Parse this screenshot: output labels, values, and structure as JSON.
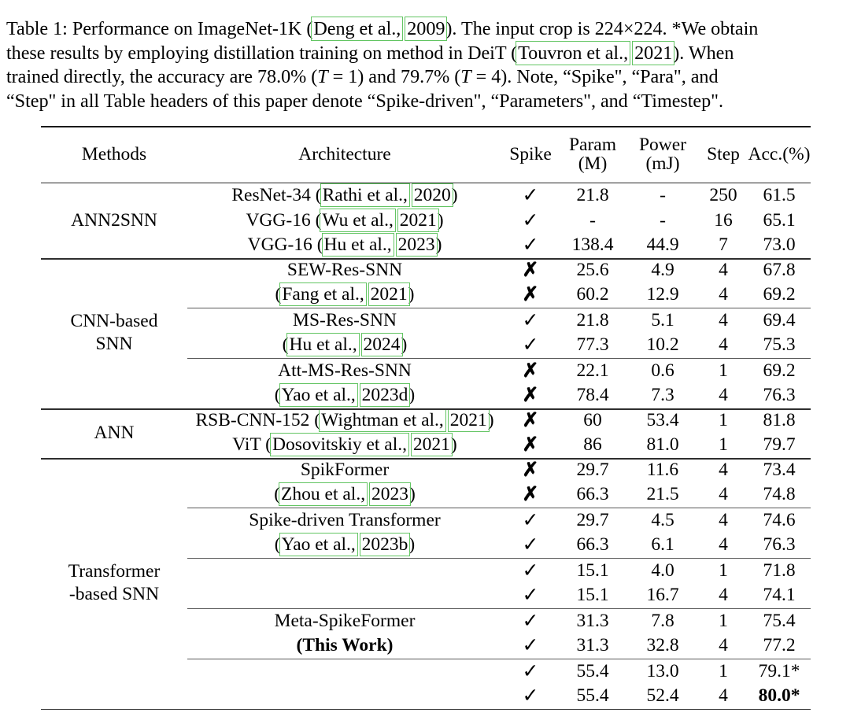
{
  "caption": {
    "lines": [
      [
        {
          "t": "Table 1: Performance on ImageNet-1K (",
          "hl": false
        },
        {
          "t": "Deng et al.,",
          "hl": true
        },
        {
          "t": " ",
          "hl": false
        },
        {
          "t": "2009",
          "hl": true
        },
        {
          "t": "). The input crop is 224×224. *We obtain",
          "hl": false
        }
      ],
      [
        {
          "t": "these results by employing distillation training on method in DeiT (",
          "hl": false
        },
        {
          "t": "Touvron et al.,",
          "hl": true
        },
        {
          "t": " ",
          "hl": false
        },
        {
          "t": "2021",
          "hl": true
        },
        {
          "t": "). When",
          "hl": false
        }
      ],
      [
        {
          "t": "trained directly, the accuracy are 78.0% (",
          "hl": false
        },
        {
          "t": "T",
          "hl": false,
          "italic": true
        },
        {
          "t": " = 1) and 79.7% (",
          "hl": false
        },
        {
          "t": "T",
          "hl": false,
          "italic": true
        },
        {
          "t": " = 4). Note, “Spike\", “Para\", and",
          "hl": false
        }
      ],
      [
        {
          "t": "“Step\" in all Table headers of this paper denote “Spike-driven\", “Parameters\", and “Timestep\".",
          "hl": false
        }
      ]
    ],
    "highlight_color": "#63c563"
  },
  "table": {
    "headers": {
      "methods": "Methods",
      "architecture": "Architecture",
      "spike": "Spike",
      "param_l1": "Param",
      "param_l2": "(M)",
      "power_l1": "Power",
      "power_l2": "(mJ)",
      "step": "Step",
      "acc": "Acc.(%)"
    },
    "marks": {
      "yes": "✓",
      "no": "✗"
    },
    "sections": [
      {
        "name": "ANN2SNN",
        "label_lines": [
          "ANN2SNN"
        ],
        "label_row_index": 1,
        "rows": [
          {
            "arch_parts": [
              {
                "t": "ResNet-34 (",
                "hl": false
              },
              {
                "t": "Rathi et al.,",
                "hl": true
              },
              {
                "t": " ",
                "hl": false
              },
              {
                "t": "2020",
                "hl": true
              },
              {
                "t": ")",
                "hl": false
              }
            ],
            "spike": "yes",
            "param": "21.8",
            "power": "-",
            "step": "250",
            "acc": "61.5",
            "acc_bold": false,
            "rule_after": "none"
          },
          {
            "arch_parts": [
              {
                "t": "VGG-16 (",
                "hl": false
              },
              {
                "t": "Wu et al.,",
                "hl": true
              },
              {
                "t": " ",
                "hl": false
              },
              {
                "t": "2021",
                "hl": true
              },
              {
                "t": ")",
                "hl": false
              }
            ],
            "spike": "yes",
            "param": "-",
            "power": "-",
            "step": "16",
            "acc": "65.1",
            "acc_bold": false,
            "rule_after": "none"
          },
          {
            "arch_parts": [
              {
                "t": "VGG-16 (",
                "hl": false
              },
              {
                "t": "Hu et al.,",
                "hl": true
              },
              {
                "t": " ",
                "hl": false
              },
              {
                "t": "2023",
                "hl": true
              },
              {
                "t": ")",
                "hl": false
              }
            ],
            "spike": "yes",
            "param": "138.4",
            "power": "44.9",
            "step": "7",
            "acc": "73.0",
            "acc_bold": false,
            "rule_after": "full"
          }
        ]
      },
      {
        "name": "CNN-based SNN",
        "label_lines": [
          "CNN-based",
          "SNN"
        ],
        "label_row_index": 2,
        "rows": [
          {
            "arch_parts": [
              {
                "t": "SEW-Res-SNN",
                "hl": false
              }
            ],
            "spike": "no",
            "param": "25.6",
            "power": "4.9",
            "step": "4",
            "acc": "67.8",
            "acc_bold": false,
            "rule_after": "none"
          },
          {
            "arch_parts": [
              {
                "t": "(",
                "hl": false
              },
              {
                "t": "Fang et al.,",
                "hl": true
              },
              {
                "t": " ",
                "hl": false
              },
              {
                "t": "2021",
                "hl": true
              },
              {
                "t": ")",
                "hl": false
              }
            ],
            "spike": "no",
            "param": "60.2",
            "power": "12.9",
            "step": "4",
            "acc": "69.2",
            "acc_bold": false,
            "rule_after": "part"
          },
          {
            "arch_parts": [
              {
                "t": "MS-Res-SNN",
                "hl": false
              }
            ],
            "spike": "yes",
            "param": "21.8",
            "power": "5.1",
            "step": "4",
            "acc": "69.4",
            "acc_bold": false,
            "rule_after": "none"
          },
          {
            "arch_parts": [
              {
                "t": "(",
                "hl": false
              },
              {
                "t": "Hu et al.,",
                "hl": true
              },
              {
                "t": " ",
                "hl": false
              },
              {
                "t": "2024",
                "hl": true
              },
              {
                "t": ")",
                "hl": false
              }
            ],
            "spike": "yes",
            "param": "77.3",
            "power": "10.2",
            "step": "4",
            "acc": "75.3",
            "acc_bold": false,
            "rule_after": "part"
          },
          {
            "arch_parts": [
              {
                "t": "Att-MS-Res-SNN",
                "hl": false
              }
            ],
            "spike": "no",
            "param": "22.1",
            "power": "0.6",
            "step": "1",
            "acc": "69.2",
            "acc_bold": false,
            "rule_after": "none"
          },
          {
            "arch_parts": [
              {
                "t": "(",
                "hl": false
              },
              {
                "t": "Yao et al.,",
                "hl": true
              },
              {
                "t": " ",
                "hl": false
              },
              {
                "t": "2023d",
                "hl": true
              },
              {
                "t": ")",
                "hl": false
              }
            ],
            "spike": "no",
            "param": "78.4",
            "power": "7.3",
            "step": "4",
            "acc": "76.3",
            "acc_bold": false,
            "rule_after": "full"
          }
        ]
      },
      {
        "name": "ANN",
        "label_lines": [
          "ANN"
        ],
        "label_row_index": 1,
        "rows": [
          {
            "arch_parts": [
              {
                "t": "RSB-CNN-152 (",
                "hl": false
              },
              {
                "t": "Wightman et al.,",
                "hl": true
              },
              {
                "t": " ",
                "hl": false
              },
              {
                "t": "2021",
                "hl": true
              },
              {
                "t": ")",
                "hl": false
              }
            ],
            "spike": "no",
            "param": "60",
            "power": "53.4",
            "step": "1",
            "acc": "81.8",
            "acc_bold": false,
            "rule_after": "none"
          },
          {
            "arch_parts": [
              {
                "t": "ViT (",
                "hl": false
              },
              {
                "t": "Dosovitskiy et al.,",
                "hl": true
              },
              {
                "t": " ",
                "hl": false
              },
              {
                "t": "2021",
                "hl": true
              },
              {
                "t": ")",
                "hl": false
              }
            ],
            "spike": "no",
            "param": "86",
            "power": "81.0",
            "step": "1",
            "acc": "79.7",
            "acc_bold": false,
            "rule_after": "full"
          }
        ]
      },
      {
        "name": "Transformer-based SNN",
        "label_lines": [
          "Transformer",
          "-based SNN"
        ],
        "label_row_index": 5,
        "rows": [
          {
            "arch_parts": [
              {
                "t": "SpikFormer",
                "hl": false
              }
            ],
            "spike": "no",
            "param": "29.7",
            "power": "11.6",
            "step": "4",
            "acc": "73.4",
            "acc_bold": false,
            "rule_after": "none"
          },
          {
            "arch_parts": [
              {
                "t": "(",
                "hl": false
              },
              {
                "t": "Zhou et al.,",
                "hl": true
              },
              {
                "t": " ",
                "hl": false
              },
              {
                "t": "2023",
                "hl": true
              },
              {
                "t": ")",
                "hl": false
              }
            ],
            "spike": "no",
            "param": "66.3",
            "power": "21.5",
            "step": "4",
            "acc": "74.8",
            "acc_bold": false,
            "rule_after": "part"
          },
          {
            "arch_parts": [
              {
                "t": "Spike-driven Transformer",
                "hl": false
              }
            ],
            "spike": "yes",
            "param": "29.7",
            "power": "4.5",
            "step": "4",
            "acc": "74.6",
            "acc_bold": false,
            "rule_after": "none"
          },
          {
            "arch_parts": [
              {
                "t": "(",
                "hl": false
              },
              {
                "t": "Yao et al.,",
                "hl": true
              },
              {
                "t": " ",
                "hl": false
              },
              {
                "t": "2023b",
                "hl": true
              },
              {
                "t": ")",
                "hl": false
              }
            ],
            "spike": "yes",
            "param": "66.3",
            "power": "6.1",
            "step": "4",
            "acc": "76.3",
            "acc_bold": false,
            "rule_after": "part"
          },
          {
            "arch_parts": [],
            "spike": "yes",
            "param": "15.1",
            "power": "4.0",
            "step": "1",
            "acc": "71.8",
            "acc_bold": false,
            "rule_after": "none"
          },
          {
            "arch_parts": [],
            "spike": "yes",
            "param": "15.1",
            "power": "16.7",
            "step": "4",
            "acc": "74.1",
            "acc_bold": false,
            "rule_after": "part"
          },
          {
            "arch_parts": [
              {
                "t": "Meta-SpikeFormer",
                "hl": false
              }
            ],
            "spike": "yes",
            "param": "31.3",
            "power": "7.8",
            "step": "1",
            "acc": "75.4",
            "acc_bold": false,
            "rule_after": "none"
          },
          {
            "arch_parts": [
              {
                "t": "(This Work)",
                "hl": false,
                "bold": true
              }
            ],
            "spike": "yes",
            "param": "31.3",
            "power": "32.8",
            "step": "4",
            "acc": "77.2",
            "acc_bold": false,
            "rule_after": "part"
          },
          {
            "arch_parts": [],
            "spike": "yes",
            "param": "55.4",
            "power": "13.0",
            "step": "1",
            "acc": "79.1*",
            "acc_bold": false,
            "rule_after": "none"
          },
          {
            "arch_parts": [],
            "spike": "yes",
            "param": "55.4",
            "power": "52.4",
            "step": "4",
            "acc": "80.0*",
            "acc_bold": true,
            "rule_after": "none"
          }
        ]
      }
    ]
  }
}
